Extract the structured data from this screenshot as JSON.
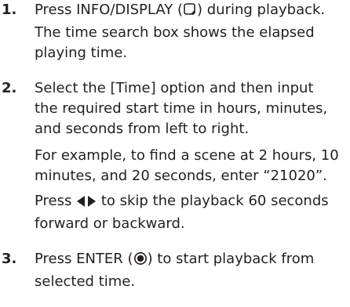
{
  "steps": [
    {
      "number": "1.",
      "paragraphs": [
        {
          "lines": [
            {
              "before": "Press INFO/DISPLAY (",
              "icon": "display-button-icon",
              "after": ") during playback."
            },
            {
              "text": "The time search box shows the elapsed"
            },
            {
              "text": "playing time."
            }
          ]
        }
      ]
    },
    {
      "number": "2.",
      "paragraphs": [
        {
          "lines": [
            {
              "text": " Select the [Time] option and then input"
            },
            {
              "text": "the required start time in hours, minutes,"
            },
            {
              "text": "and seconds from left to right."
            }
          ]
        },
        {
          "lines": [
            {
              "text": "For example, to find a scene at 2 hours, 10"
            },
            {
              "text": "minutes, and 20 seconds, enter “21020”."
            }
          ]
        },
        {
          "lines": [
            {
              "before": "Press ",
              "icon": "left-right-arrows-icon",
              "after": " to skip the playback 60 seconds"
            },
            {
              "text": "forward or backward."
            }
          ]
        }
      ]
    },
    {
      "number": "3.",
      "paragraphs": [
        {
          "lines": [
            {
              "before": "Press ENTER (",
              "icon": "enter-button-icon",
              "after": ") to start playback from"
            },
            {
              "text": "selected time."
            }
          ]
        }
      ]
    }
  ]
}
